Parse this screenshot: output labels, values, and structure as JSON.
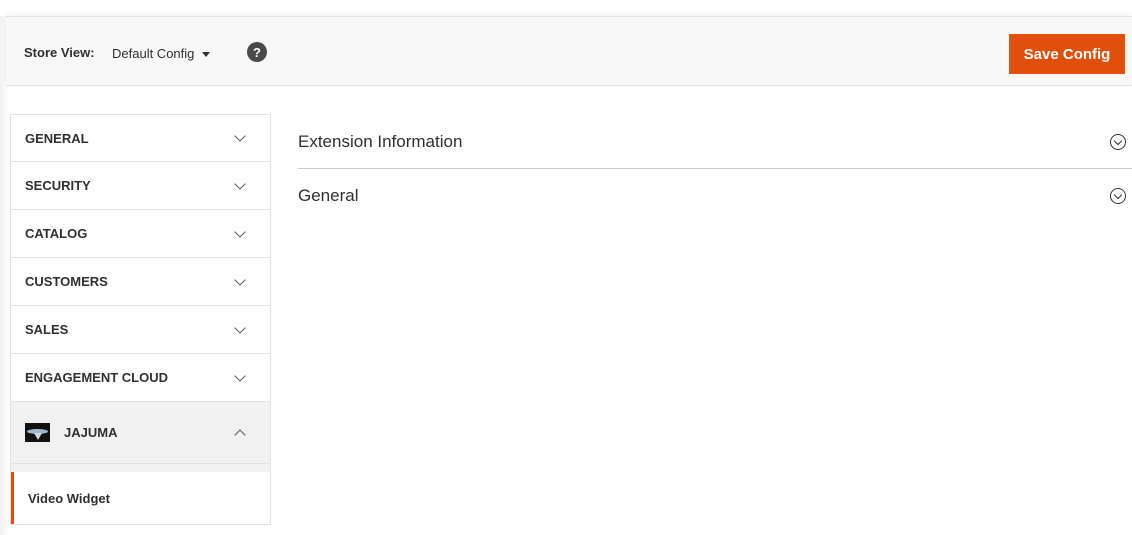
{
  "store_view": {
    "label": "Store View:",
    "selected": "Default Config",
    "help": "?"
  },
  "toolbar": {
    "save_label": "Save Config"
  },
  "sidebar": {
    "tabs": [
      {
        "label": "GENERAL"
      },
      {
        "label": "SECURITY"
      },
      {
        "label": "CATALOG"
      },
      {
        "label": "CUSTOMERS"
      },
      {
        "label": "SALES"
      },
      {
        "label": "ENGAGEMENT CLOUD"
      },
      {
        "label": "JAJUMA"
      }
    ],
    "subitems": [
      {
        "label": "Video Widget"
      }
    ]
  },
  "main": {
    "sections": [
      {
        "title": "Extension Information"
      },
      {
        "title": "General"
      }
    ]
  },
  "colors": {
    "accent": "#e04f0b",
    "header_bg": "#f8f8f8",
    "active_tab_bg": "#f1f1f1"
  },
  "icons": {
    "help": "question-circle-icon",
    "chevron": "chevron-down-icon",
    "section_toggle": "circle-chevron-icon"
  }
}
